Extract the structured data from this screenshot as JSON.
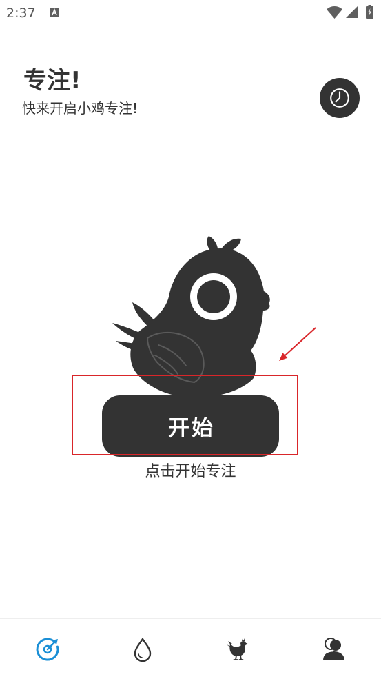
{
  "status_bar": {
    "time": "2:37",
    "icons": [
      "text-a-notification-icon",
      "wifi-icon",
      "signal-icon",
      "battery-charging-icon"
    ]
  },
  "header": {
    "title": "专注!",
    "subtitle": "快来开启小鸡专注!",
    "history_button_icon": "clock-icon"
  },
  "main": {
    "illustration": "chick-illustration",
    "start_button_label": "开始",
    "hint": "点击开始专注"
  },
  "annotation": {
    "highlight_color": "#d9262a"
  },
  "bottom_nav": {
    "items": [
      {
        "icon": "focus-dial-icon",
        "active": true
      },
      {
        "icon": "water-drop-icon",
        "active": false
      },
      {
        "icon": "chicken-icon",
        "active": false
      },
      {
        "icon": "profile-icon",
        "active": false
      }
    ]
  },
  "colors": {
    "primary": "#333333",
    "accent": "#1a8fd6",
    "background": "#ffffff"
  }
}
